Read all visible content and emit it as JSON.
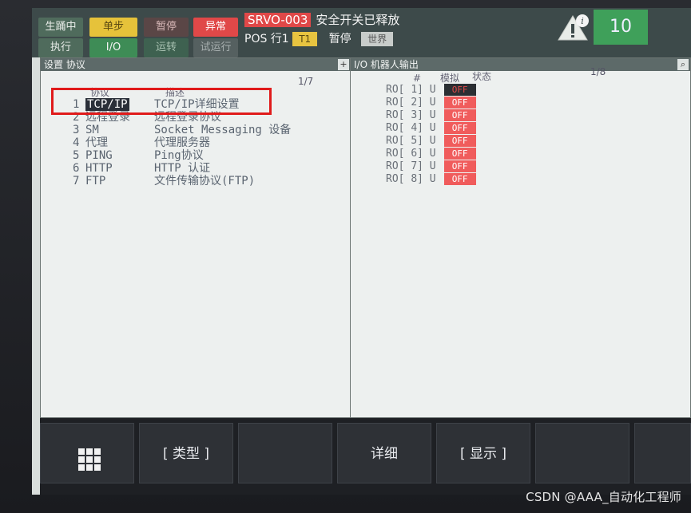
{
  "status_bar": {
    "left_top": "生踊中",
    "single_step": "单步",
    "pause": "暂停",
    "fault": "异常",
    "left_bottom": "执行",
    "io": "I/O",
    "run": "运转",
    "test_run": "试运行",
    "alarm_code": "SRVO-003",
    "alarm_text": "安全开关已释放",
    "pos_label": "POS",
    "line_label": "行1",
    "t1_badge": "T1",
    "paused_text": "暂停",
    "world_badge": "世界",
    "override": "10"
  },
  "left_panel": {
    "title": "设置 协议",
    "page": "1/7",
    "col_protocol": "协议",
    "col_desc": "描述",
    "rows": [
      {
        "num": "1",
        "protocol": "TCP/IP",
        "desc": "TCP/IP详细设置"
      },
      {
        "num": "2",
        "protocol": "远程登录",
        "desc": "远程登录协议"
      },
      {
        "num": "3",
        "protocol": "SM",
        "desc": "Socket Messaging 设备"
      },
      {
        "num": "4",
        "protocol": "代理",
        "desc": "代理服务器"
      },
      {
        "num": "5",
        "protocol": "PING",
        "desc": "Ping协议"
      },
      {
        "num": "6",
        "protocol": "HTTP",
        "desc": "HTTP 认证"
      },
      {
        "num": "7",
        "protocol": "FTP",
        "desc": "文件传输协议(FTP)"
      }
    ]
  },
  "right_panel": {
    "title": "I/O 机器人输出",
    "page": "1/8",
    "col_num": "#",
    "col_sim": "模拟",
    "col_state": "状态",
    "rows": [
      {
        "label": "RO[",
        "index": "1]",
        "sim": "U",
        "state": "OFF"
      },
      {
        "label": "RO[",
        "index": "2]",
        "sim": "U",
        "state": "OFF"
      },
      {
        "label": "RO[",
        "index": "3]",
        "sim": "U",
        "state": "OFF"
      },
      {
        "label": "RO[",
        "index": "4]",
        "sim": "U",
        "state": "OFF"
      },
      {
        "label": "RO[",
        "index": "5]",
        "sim": "U",
        "state": "OFF"
      },
      {
        "label": "RO[",
        "index": "6]",
        "sim": "U",
        "state": "OFF"
      },
      {
        "label": "RO[",
        "index": "7]",
        "sim": "U",
        "state": "OFF"
      },
      {
        "label": "RO[",
        "index": "8]",
        "sim": "U",
        "state": "OFF"
      }
    ]
  },
  "function_keys": {
    "f2": "[ 类型 ]",
    "f4": "详细",
    "f5": "[ 显示 ]"
  },
  "watermark": "CSDN @AAA_自动化工程师"
}
